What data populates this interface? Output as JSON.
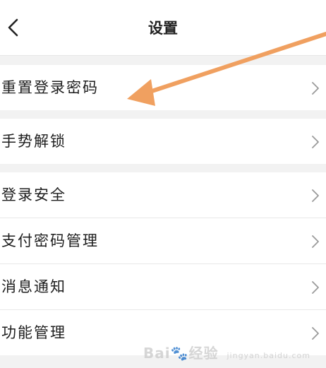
{
  "header": {
    "title": "设置",
    "back_icon": "chevron-left-icon"
  },
  "groups": [
    {
      "items": [
        {
          "label": "重置登录密码",
          "icon": "chevron-right-icon"
        }
      ]
    },
    {
      "items": [
        {
          "label": "手势解锁",
          "icon": "chevron-right-icon"
        }
      ]
    },
    {
      "items": [
        {
          "label": "登录安全",
          "icon": "chevron-right-icon"
        },
        {
          "label": "支付密码管理",
          "icon": "chevron-right-icon"
        },
        {
          "label": "消息通知",
          "icon": "chevron-right-icon"
        },
        {
          "label": "功能管理",
          "icon": "chevron-right-icon"
        }
      ]
    }
  ],
  "annotation": {
    "color": "#f0a060"
  },
  "watermark": {
    "brand": "Bai",
    "brand_end": "经验",
    "sub": "jingyan.baidu.com"
  },
  "colors": {
    "background": "#f2f2f2",
    "card": "#ffffff",
    "chevron": "#9a9a9a"
  }
}
